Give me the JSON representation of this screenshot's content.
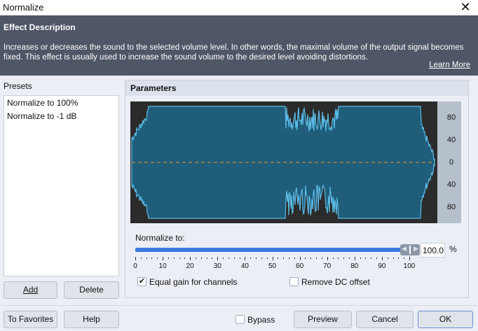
{
  "window": {
    "title": "Normalize",
    "close_icon": "close-icon"
  },
  "description": {
    "heading": "Effect Description",
    "text": "Increases or decreases the sound to the selected volume level. In other words, the maximal volume of the output signal becomes fixed. This effect is usually used to increase the sound volume to the desired level avoiding distortions.",
    "learn_more": "Learn More"
  },
  "presets": {
    "label": "Presets",
    "items": [
      "Normalize to 100%",
      "Normalize to -1 dB"
    ],
    "add": "Add",
    "delete": "Delete"
  },
  "parameters": {
    "heading": "Parameters",
    "scale_labels": [
      "80",
      "40",
      "0",
      "40",
      "80"
    ],
    "normalize_label": "Normalize to:",
    "normalize_value": "100.0",
    "unit": "%",
    "slider_percent": 100,
    "ticks": [
      "0",
      "10",
      "20",
      "30",
      "40",
      "50",
      "60",
      "70",
      "80",
      "90",
      "100"
    ],
    "equal_gain": {
      "label": "Equal gain for channels",
      "checked": true
    },
    "remove_dc": {
      "label": "Remove DC offset",
      "checked": false
    }
  },
  "footer": {
    "to_favorites": "To Favorites",
    "help": "Help",
    "bypass": "Bypass",
    "bypass_checked": false,
    "preview": "Preview",
    "cancel": "Cancel",
    "ok": "OK"
  },
  "colors": {
    "wave_fill": "#1f5d7a",
    "wave_line": "#5bbbe6",
    "wave_bg": "#2b2b2b",
    "center_line": "#e8962a",
    "desc_bg": "#4f5666",
    "slider": "#3b7be0"
  }
}
